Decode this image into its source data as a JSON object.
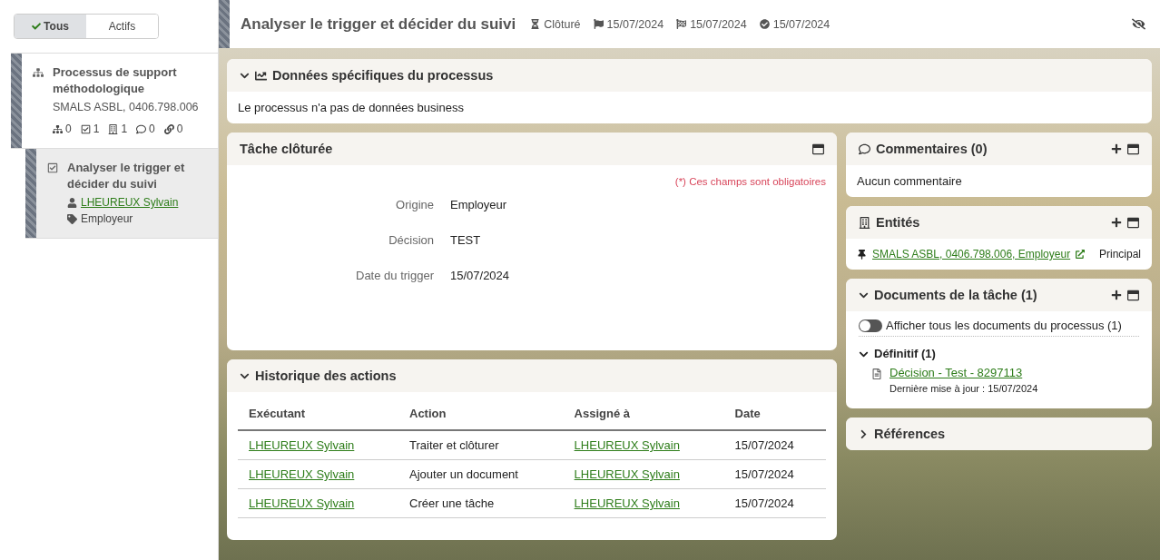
{
  "filter_toggle": [
    {
      "label": "Tous",
      "selected": true
    },
    {
      "label": "Actifs",
      "selected": false
    }
  ],
  "tree": {
    "title": "Processus de support méthodologique",
    "subtitle": "SMALS ASBL, 0406.798.006",
    "counts": [
      {
        "kind": "subprocess",
        "value": "0"
      },
      {
        "kind": "task",
        "value": "1"
      },
      {
        "kind": "entity",
        "value": "1"
      },
      {
        "kind": "comment",
        "value": "0"
      },
      {
        "kind": "link",
        "value": "0"
      }
    ],
    "children": [
      {
        "title": "Analyser le trigger et décider du suivi",
        "assignee": "LHEUREUX Sylvain",
        "tag": "Employeur",
        "selected": true
      }
    ]
  },
  "header": {
    "title": "Analyser le trigger et décider du suivi",
    "meta": [
      {
        "kind": "status",
        "text": "Clôturé"
      },
      {
        "kind": "start",
        "text": "15/07/2024"
      },
      {
        "kind": "end",
        "text": "15/07/2024"
      },
      {
        "kind": "done",
        "text": "15/07/2024"
      }
    ]
  },
  "business_data": {
    "title": "Données spécifiques du processus",
    "expanded": true,
    "text": "Le processus n'a pas de données business"
  },
  "task": {
    "title": "Tâche clôturée",
    "required_note": "(*) Ces champs sont obligatoires",
    "fields": [
      {
        "label": "Origine",
        "value": "Employeur"
      },
      {
        "label": "Décision",
        "value": "TEST"
      },
      {
        "label": "Date du trigger",
        "value": "15/07/2024"
      }
    ]
  },
  "history": {
    "title": "Historique des actions",
    "expanded": true,
    "columns": [
      "Exécutant",
      "Action",
      "Assigné à",
      "Date"
    ],
    "rows": [
      [
        "LHEUREUX Sylvain",
        "Traiter et clôturer",
        "LHEUREUX Sylvain",
        "15/07/2024"
      ],
      [
        "LHEUREUX Sylvain",
        "Ajouter un document",
        "LHEUREUX Sylvain",
        "15/07/2024"
      ],
      [
        "LHEUREUX Sylvain",
        "Créer une tâche",
        "LHEUREUX Sylvain",
        "15/07/2024"
      ]
    ]
  },
  "comments": {
    "title": "Commentaires (0)",
    "text": "Aucun commentaire"
  },
  "entities": {
    "title": "Entités",
    "items": [
      {
        "label": "SMALS ASBL, 0406.798.006, Employeur",
        "role": "Principal"
      }
    ]
  },
  "documents": {
    "title": "Documents de la tâche (1)",
    "expanded": true,
    "toggle": {
      "label": "Afficher tous les documents du processus (1)",
      "on": false
    },
    "groups": [
      {
        "title": "Définitif (1)",
        "expanded": true,
        "items": [
          {
            "name": "Décision - Test - 8297113",
            "updated": "Dernière mise à jour : 15/07/2024"
          }
        ]
      }
    ]
  },
  "references": {
    "title": "Références",
    "expanded": false
  }
}
